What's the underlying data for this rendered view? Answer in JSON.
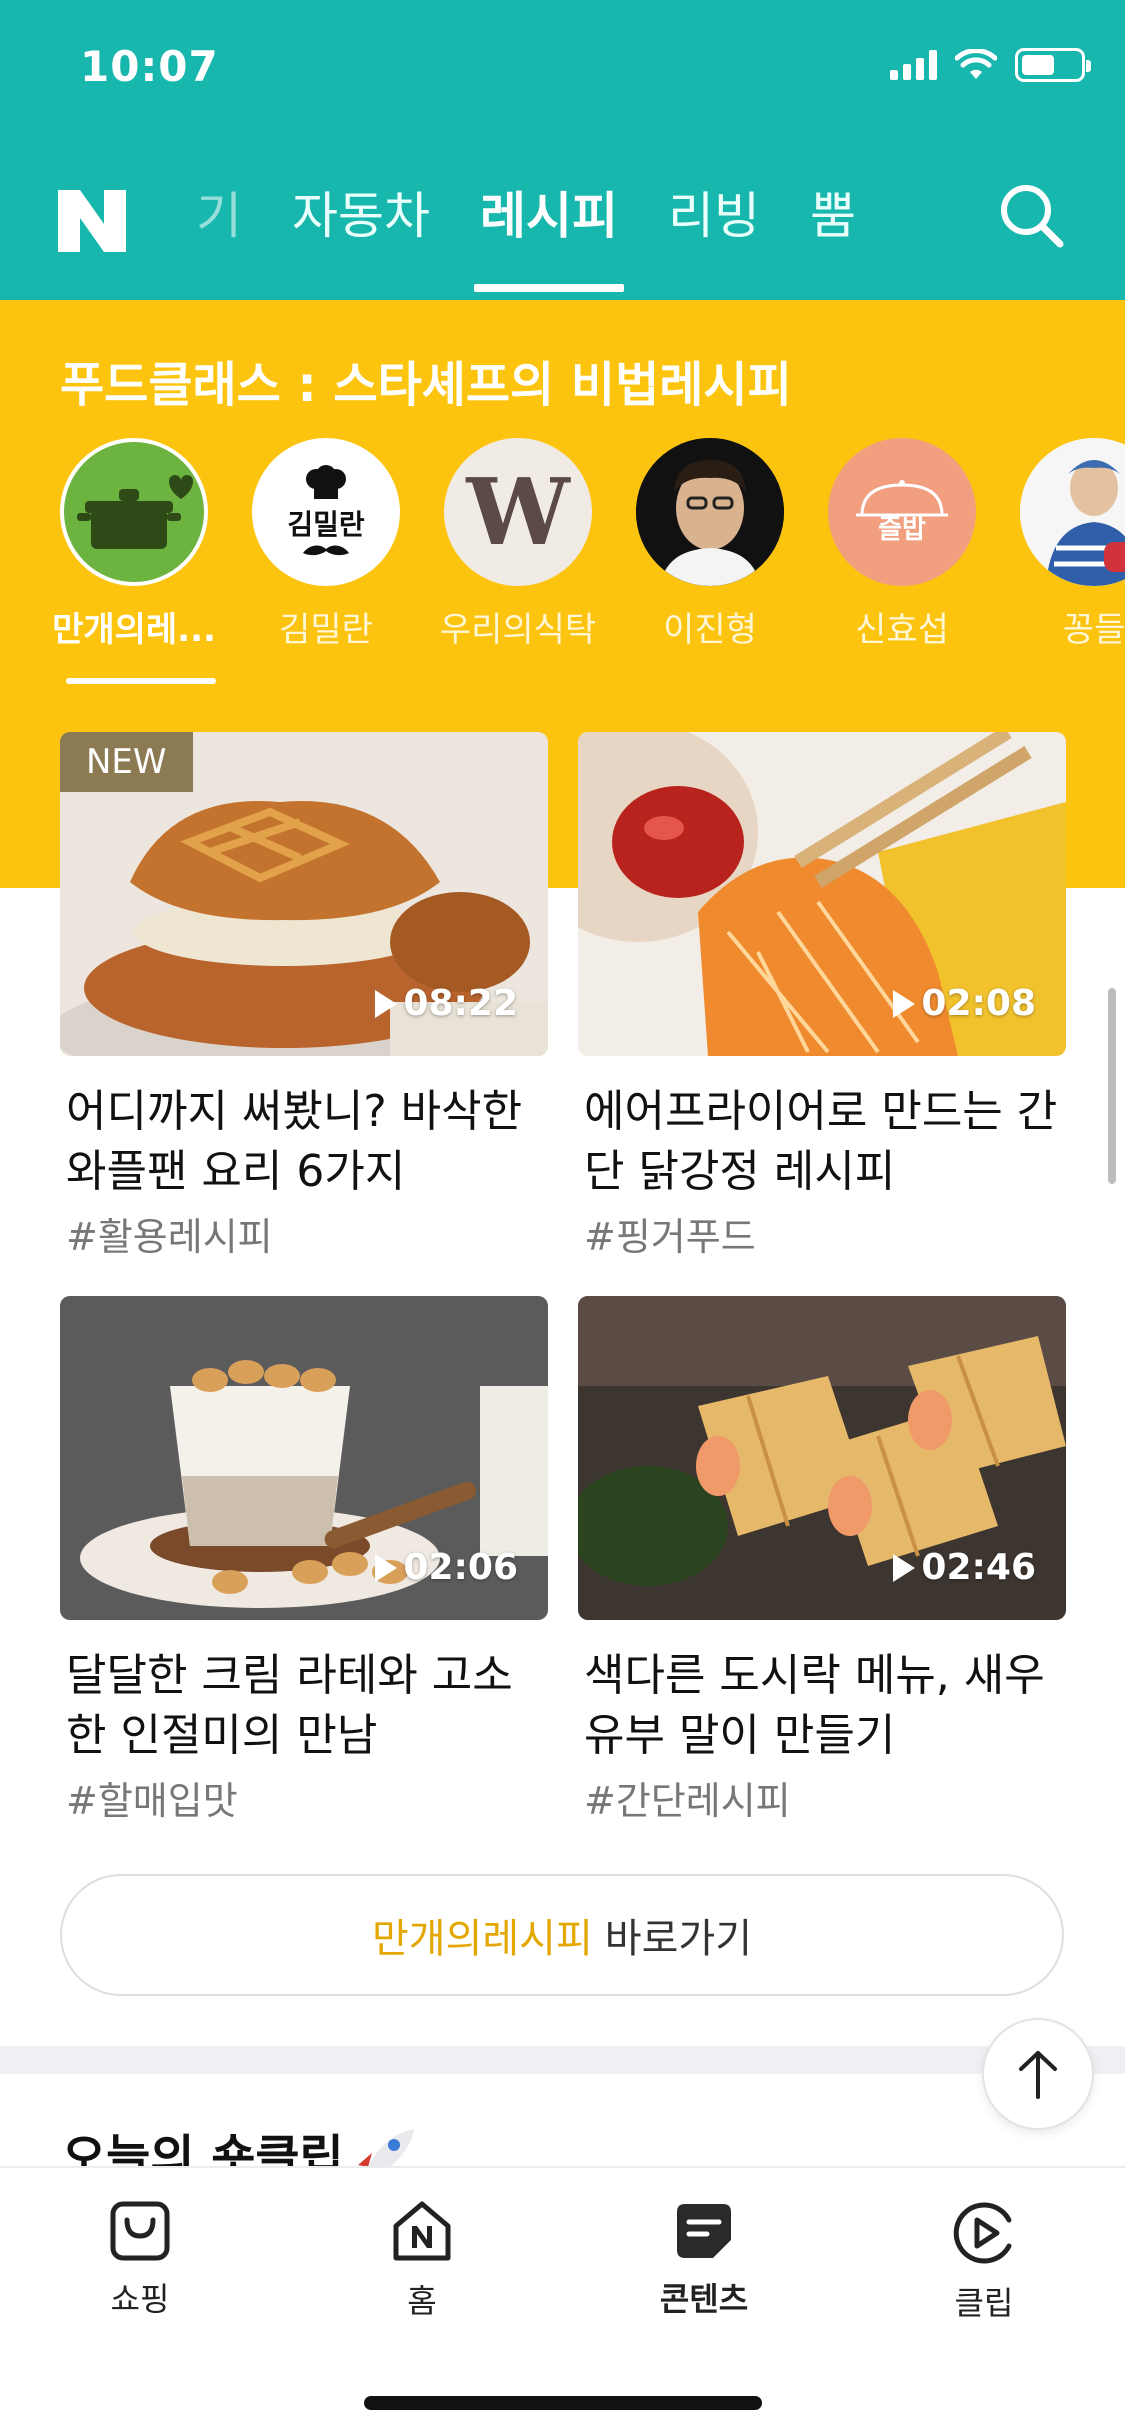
{
  "status_bar": {
    "time": "10:07"
  },
  "header": {
    "logo": "N",
    "tabs": [
      {
        "label": "기"
      },
      {
        "label": "자동차"
      },
      {
        "label": "레시피"
      },
      {
        "label": "리빙"
      },
      {
        "label": "뿜"
      }
    ],
    "active_tab": "레시피",
    "icons": [
      "signal-icon",
      "wifi-icon",
      "battery-icon",
      "search-icon"
    ],
    "accent_color": "#18b7ad"
  },
  "foodclass": {
    "title": "푸드클래스 : 스타셰프의 비법레시피",
    "band_color": "#fdc40f",
    "chefs": [
      {
        "name": "만개의레...",
        "active": true
      },
      {
        "name": "김밀란"
      },
      {
        "name": "우리의식탁"
      },
      {
        "name": "이진형"
      },
      {
        "name": "신효섭"
      },
      {
        "name": "꽁들"
      }
    ],
    "avatar_texts": {
      "kimmilan": "김밀란",
      "woori": "W",
      "shinhyoseop": "즐밥"
    }
  },
  "videos": [
    {
      "badge": "NEW",
      "duration": "08:22",
      "title": "어디까지 써봤니? 바삭한 와플팬 요리 6가지",
      "tag": "#활용레시피"
    },
    {
      "duration": "02:08",
      "title": "에어프라이어로 만드는 간단 닭강정 레시피",
      "tag": "#핑거푸드"
    },
    {
      "duration": "02:06",
      "title": "달달한 크림 라테와 고소한 인절미의 만남",
      "tag": "#할매입맛"
    },
    {
      "duration": "02:46",
      "title": "색다른 도시락 메뉴, 새우 유부 말이 만들기",
      "tag": "#간단레시피"
    }
  ],
  "cta": {
    "accent": "만개의레시피",
    "label": "바로가기"
  },
  "next_section": {
    "title": "오늘의 숏클립"
  },
  "bottom_nav": [
    {
      "label": "쇼핑",
      "icon": "shopping-bag-icon"
    },
    {
      "label": "홈",
      "icon": "home-icon"
    },
    {
      "label": "콘텐츠",
      "icon": "contents-icon",
      "active": true
    },
    {
      "label": "클립",
      "icon": "clip-icon"
    }
  ]
}
